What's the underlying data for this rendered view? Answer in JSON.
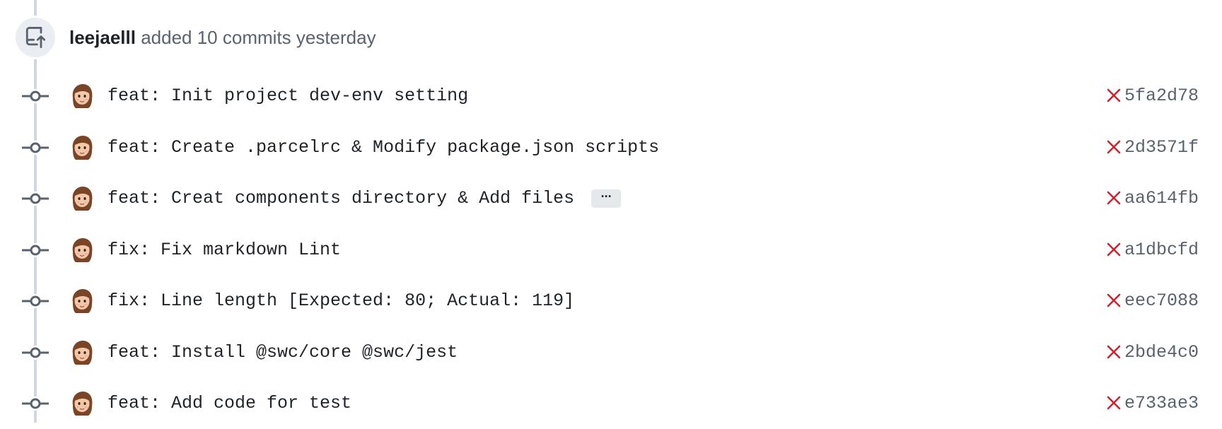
{
  "event": {
    "icon": "repo-push-icon",
    "author": "leejaelll",
    "action_text": "added 10 commits yesterday"
  },
  "commits": [
    {
      "message": "feat: Init project dev-env setting",
      "sha": "5fa2d78",
      "status": "failed",
      "has_more": false
    },
    {
      "message": "feat: Create .parcelrc & Modify package.json scripts",
      "sha": "2d3571f",
      "status": "failed",
      "has_more": false
    },
    {
      "message": "feat: Creat components directory & Add files",
      "sha": "aa614fb",
      "status": "failed",
      "has_more": true
    },
    {
      "message": "fix: Fix markdown Lint",
      "sha": "a1dbcfd",
      "status": "failed",
      "has_more": false
    },
    {
      "message": "fix: Line length [Expected: 80; Actual: 119]",
      "sha": "eec7088",
      "status": "failed",
      "has_more": false
    },
    {
      "message": "feat: Install @swc/core @swc/jest",
      "sha": "2bde4c0",
      "status": "failed",
      "has_more": false
    },
    {
      "message": "feat: Add code for test",
      "sha": "e733ae3",
      "status": "failed",
      "has_more": false
    }
  ],
  "ellipsis_label": "···",
  "colors": {
    "failed": "#cf222e",
    "timeline": "#d0d7de",
    "muted_text": "#59636e"
  }
}
